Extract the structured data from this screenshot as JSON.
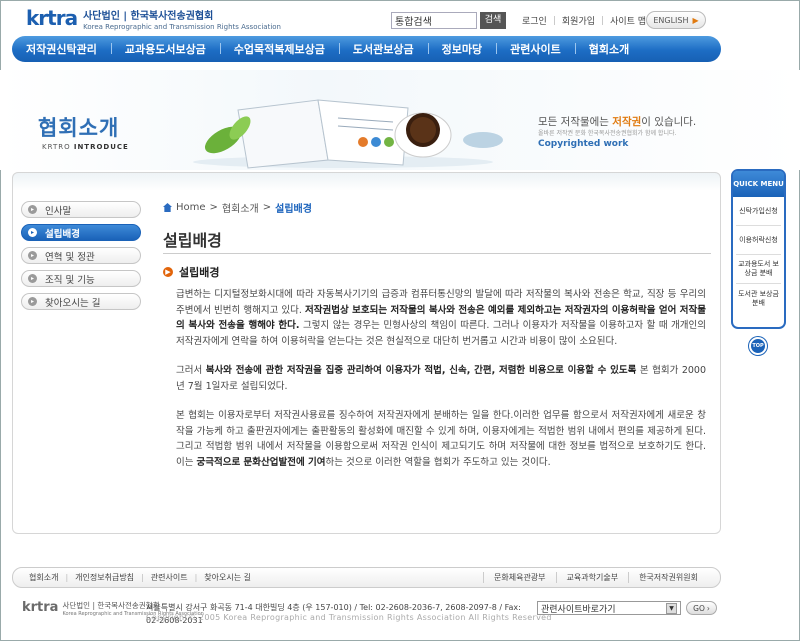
{
  "header": {
    "logo_mark": "krtra",
    "logo_ko": "사단법인 | 한국복사전송권협회",
    "logo_en": "Korea Reprographic and Transmission Rights Association",
    "search_placeholder": "통합검색",
    "search_button": "검색",
    "util_links": [
      "로그인",
      "회원가입",
      "사이트 맵"
    ],
    "english_button": "ENGLISH"
  },
  "gnb": [
    "저작권신탁관리",
    "교과용도서보상금",
    "수업목적복제보상금",
    "도서관보상금",
    "정보마당",
    "관련사이트",
    "협회소개"
  ],
  "banner": {
    "title": "협회소개",
    "sub_prefix": "KRTRO",
    "sub_main": "INTRODUCE",
    "slogan_prefix": "모든 저작물에는 ",
    "slogan_highlight": "저작권",
    "slogan_suffix": "이 있습니다.",
    "slogan_small": "올바른 저작권 문화 한국복사전송권협회가 함께 합니다.",
    "slogan_en": "Copyrighted work"
  },
  "lnb": [
    {
      "label": "인사말",
      "active": false
    },
    {
      "label": "설립배경",
      "active": true
    },
    {
      "label": "연혁 및 정관",
      "active": false
    },
    {
      "label": "조직 및 기능",
      "active": false
    },
    {
      "label": "찾아오시는 길",
      "active": false
    }
  ],
  "breadcrumb": {
    "home": "Home",
    "parent": "협회소개",
    "current": "설립배경"
  },
  "page_title": "설립배경",
  "section_title": "설립배경",
  "paragraphs": {
    "p1_a": "급변하는 디지털정보화시대에 따라 자동복사기기의 급증과 컴퓨터통신망의 발달에 따라 저작물의 복사와 전송은 학교, 직장 등 우리의 주변에서 빈번히 행해지고 있다. ",
    "p1_b": "저작권법상 보호되는 저작물의 복사와 전송은 예외를 제외하고는 저작권자의 이용허락을 얻어 저작물의 복사와 전송을 행해야 한다.",
    "p1_c": " 그렇지 않는 경우는 민형사상의 책임이 따른다. 그러나 이용자가 저작물을 이용하고자 할 때 개개인의 저작권자에게 연락을 하여 이용허락을 얻는다는 것은 현실적으로 대단히 번거롭고 시간과 비용이 많이 소요된다.",
    "p2_a": "그러서 ",
    "p2_b": "복사와 전송에 관한 저작권을 집중 관리하여 이용자가 적법, 신속, 간편, 저렴한 비용으로 이용할 수 있도록",
    "p2_c": " 본 협회가 2000년 7월 1일자로 설립되었다.",
    "p3_a": "본 협회는 이용자로부터 저작권사용료를 징수하여 저작권자에게 분배하는 일을 한다.이러한 업무를 함으로서 저작권자에게 새로운 창작을 가능케 하고 출판권자에게는 출판활동의 활성화에 매진할 수 있게 하며, 이용자에게는 적법한 범위 내에서 편의를 제공하게 된다. 그리고 적법함 범위 내에서 저작물을 이용함으로써 저작권 인식이 제고되기도 하며 저작물에 대한 정보를 법적으로 보호하기도 한다. 이는 ",
    "p3_b": "궁극적으로 문화산업발전에 기여",
    "p3_c": "하는 것으로 이러한 역할을 협회가 주도하고 있는 것이다."
  },
  "quick_menu": {
    "title": "QUICK MENU",
    "items": [
      "신탁가입신청",
      "이용허락신청",
      "교과용도서 보상금 분배",
      "도서관 보상금 분배"
    ],
    "top": "TOP"
  },
  "footer": {
    "left_links": [
      "협회소개",
      "개인정보취급방침",
      "관련사이트",
      "찾아오시는 길"
    ],
    "right_links": [
      "문화체육관광부",
      "교육과학기술부",
      "한국저작권위원회"
    ],
    "logo_mark": "krtra",
    "logo_ko": "사단법인 | 한국복사전송권협회",
    "logo_en": "Korea Reprographic and Transmission Rights Association",
    "address": "서울특별시 강서구 화곡동 71-4 대한빌딩 4층 (우 157-010) / Tel: 02-2608-2036-7, 2608-2097-8 / Fax: 02-2608-2031",
    "copyright": "Copyright© 2005 Korea Reprographic and Transmission Rights Association All Rights Reserved",
    "site_select": "관련사이트바로가기",
    "go": "GO"
  },
  "colors": {
    "primary": "#1c64bd",
    "accent": "#e07a10"
  }
}
